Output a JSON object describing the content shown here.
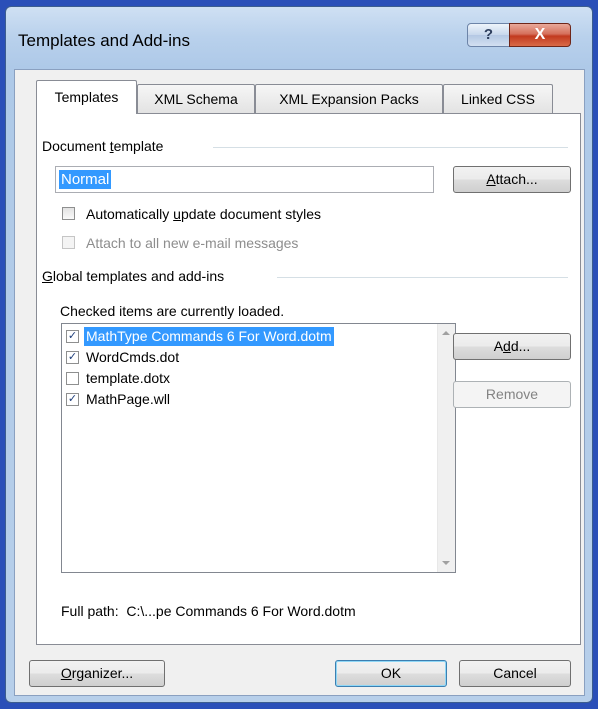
{
  "window": {
    "title": "Templates and Add-ins",
    "help_glyph": "?",
    "close_glyph": "X"
  },
  "tabs": [
    {
      "label": "Templates",
      "active": true
    },
    {
      "label": "XML Schema",
      "active": false
    },
    {
      "label": "XML Expansion Packs",
      "active": false
    },
    {
      "label": "Linked CSS",
      "active": false
    }
  ],
  "document_template": {
    "group_label_pre": "Document ",
    "group_label_u": "t",
    "group_label_post": "emplate",
    "value": "Normal",
    "attach_pre": "",
    "attach_u": "A",
    "attach_post": "ttach...",
    "auto_update_pre": "Automatically ",
    "auto_update_u": "u",
    "auto_update_post": "pdate document styles",
    "auto_update_checked": false,
    "attach_all_label": "Attach to all new e-mail messages",
    "attach_all_checked": false,
    "attach_all_enabled": false
  },
  "global_templates": {
    "group_label_pre": "",
    "group_label_u": "G",
    "group_label_post": "lobal templates and add-ins",
    "hint": "Checked items are currently loaded.",
    "items": [
      {
        "label": "MathType Commands 6 For Word.dotm",
        "checked": true,
        "selected": true
      },
      {
        "label": "WordCmds.dot",
        "checked": true,
        "selected": false
      },
      {
        "label": "template.dotx",
        "checked": false,
        "selected": false
      },
      {
        "label": "MathPage.wll",
        "checked": true,
        "selected": false
      }
    ],
    "add_pre": "A",
    "add_u": "d",
    "add_post": "d...",
    "remove_label": "Remove",
    "full_path_label": "Full path:",
    "full_path_value": "C:\\...pe Commands 6 For Word.dotm"
  },
  "footer": {
    "organizer_pre": "",
    "organizer_u": "O",
    "organizer_post": "rganizer...",
    "ok_label": "OK",
    "cancel_label": "Cancel"
  },
  "icons": {
    "check_glyph": "✓"
  }
}
